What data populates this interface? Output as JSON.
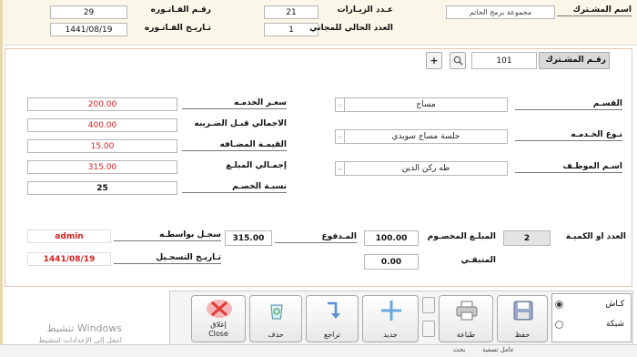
{
  "header": {
    "subscriber_label": "اسم المشـترك",
    "subscriber_value": "مجموعة برمج الحاتم",
    "visits_label": "عـدد الزيـارات",
    "visits_value": "21",
    "free_label": "العدد الحالي للمجاني",
    "free_value": "1",
    "invoice_no_label": "رقـم الفـاتـوره",
    "invoice_no_value": "29",
    "invoice_date_label": "تـاريـخ الفـاتـوره",
    "invoice_date_value": "1441/08/19"
  },
  "subscriber_no": {
    "label": "رقـم المشـترك",
    "value": "101",
    "search_icon": "magnifier-icon",
    "add_label": "+"
  },
  "service": {
    "department_label": "القسـم",
    "department_value": "مساج",
    "type_label": "نـوع الخـدمـه",
    "type_value": "جلسة مساج سويدي",
    "employee_label": "اسـم الموظـف",
    "employee_value": "طه ركن الدين"
  },
  "pricing": {
    "price_label": "سعـر الخدمـه",
    "price_value": "200.00",
    "pre_tax_label": "الاجمالي قبـل الضـريبه",
    "pre_tax_value": "400.00",
    "vat_label": "القيمـة المضـافه",
    "vat_value": "15.00",
    "total_label": "إجمـالي المبلـغ",
    "total_value": "315.00",
    "discount_label": "نسبـة الخصـم",
    "discount_value": "25"
  },
  "payment": {
    "qty_label": "العدد او الكميـة",
    "qty_value": "2",
    "discounted_label": "المبلـغ المخصـوم",
    "discounted_value": "100.00",
    "paid_label": "المـدفوع",
    "paid_value": "315.00",
    "remaining_label": "المتبقـي",
    "remaining_value": "0.00"
  },
  "record": {
    "by_label": "سجـل بواسطـه",
    "by_value": "admin",
    "date_label": "تـاريـخ التسجـيل",
    "date_value": "1441/08/19"
  },
  "toolbar": {
    "close_label": "إغلاق Close",
    "delete_label": "حذف",
    "undo_label": "تراجع",
    "new_label": "جديد",
    "print_label": "طباعة",
    "save_label": "حفظ"
  },
  "options": {
    "opt1": "كـاش",
    "opt2": "شبكة"
  },
  "watermark": {
    "line1": "تنشيط Windows",
    "line2": "انتقل إلى الإعدادات لتنشيط"
  },
  "status": {
    "left": "بحث",
    "middle": "عامل تصفية"
  },
  "colors": {
    "accent_red": "#d62020",
    "panel_border": "#e7c2b2",
    "header_bg": "#fbf7e8"
  }
}
